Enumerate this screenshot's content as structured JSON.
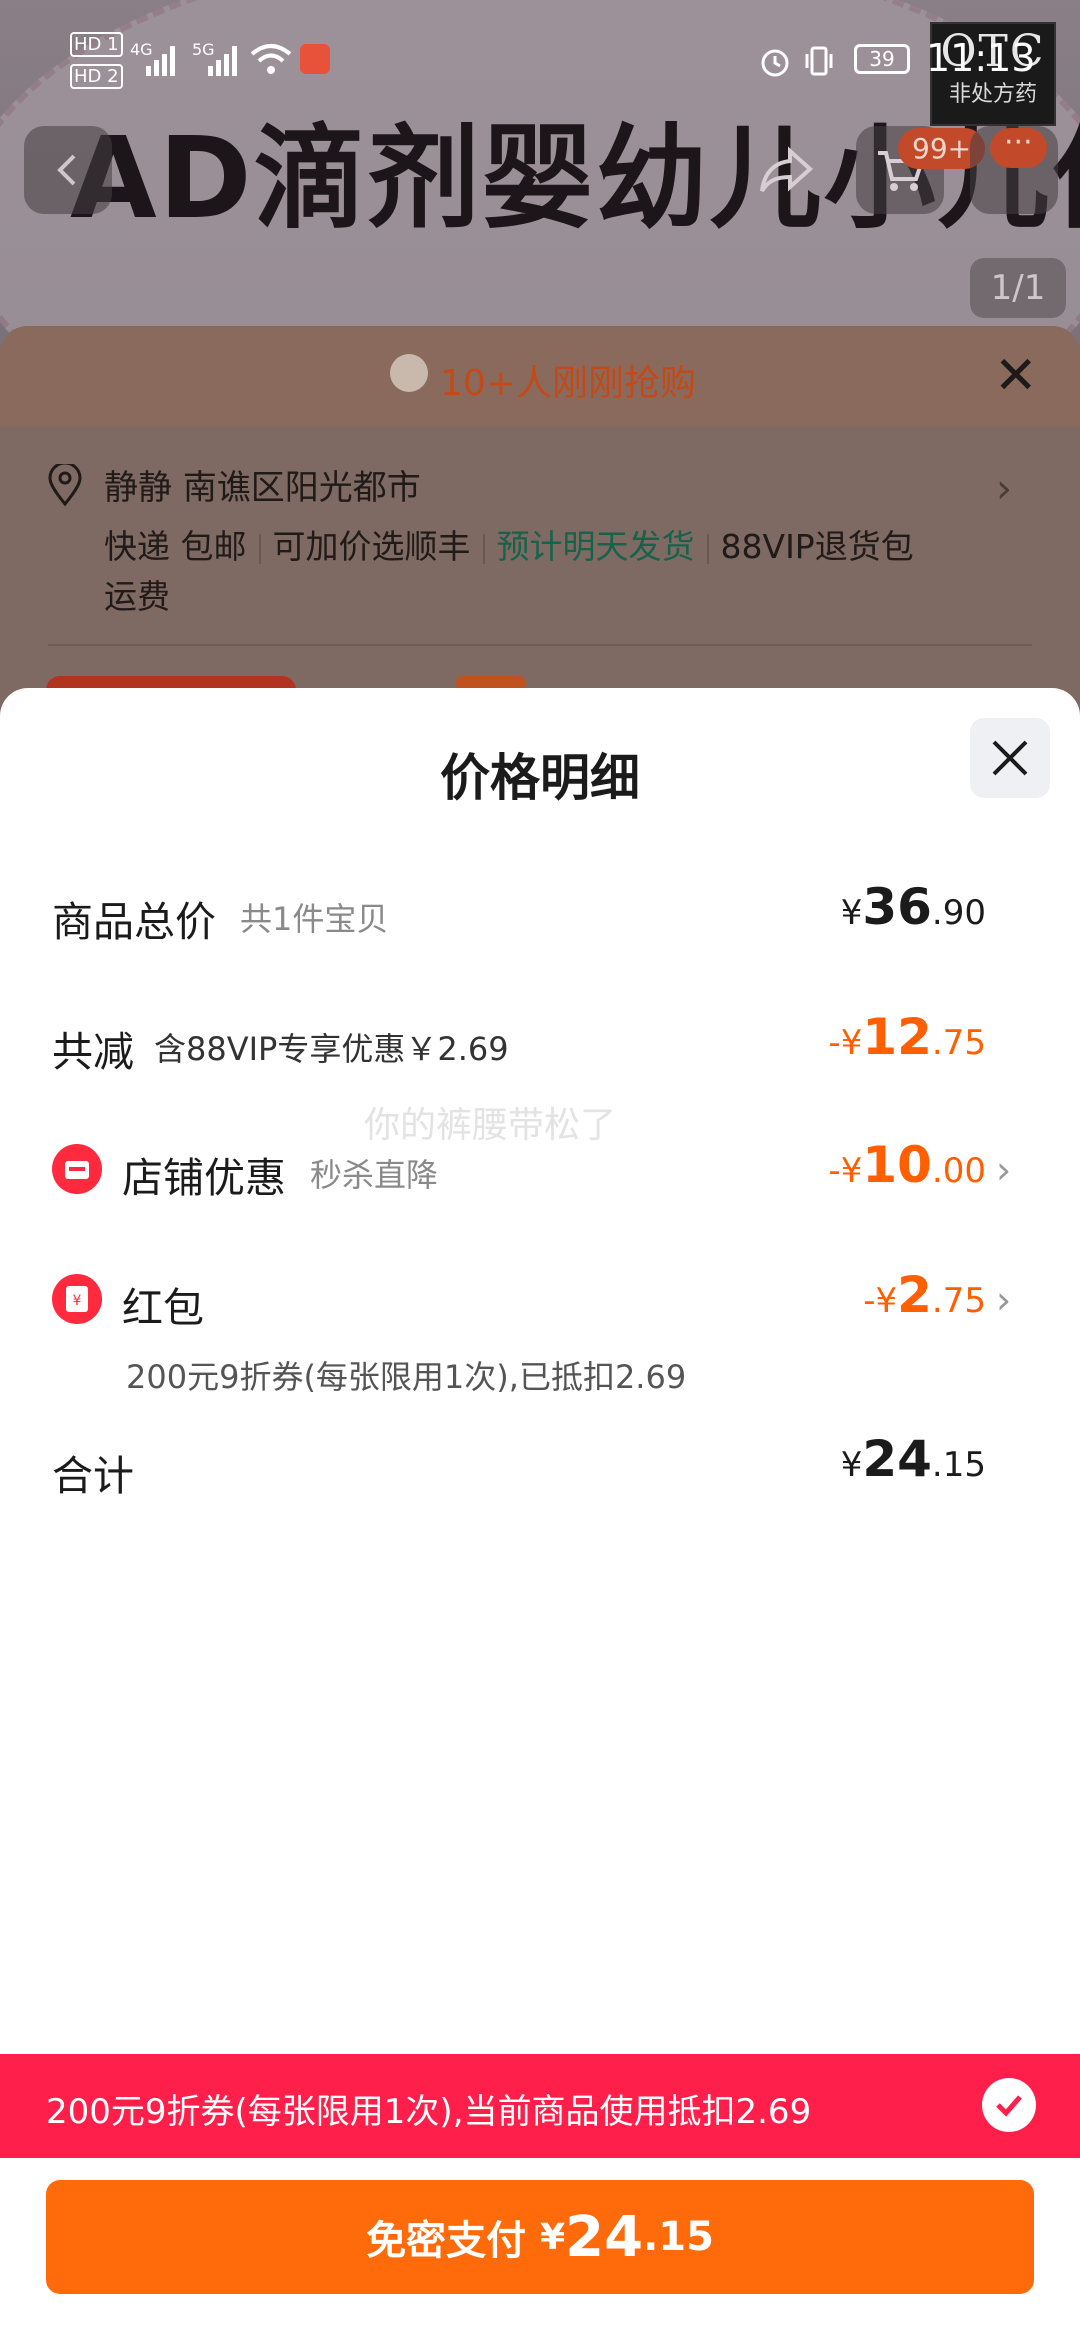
{
  "status_bar": {
    "hd1": "HD 1",
    "hd2": "HD 2",
    "net1": "4G",
    "net2": "5G",
    "battery": "39",
    "time": "11:13"
  },
  "background_page": {
    "product_title": "AD滴剂婴幼儿小儿佝偻病",
    "cart_badge": "99+",
    "more_badge": "···",
    "pager": "1/1",
    "otc_logo": "OTC",
    "otc_sub": "非处方药"
  },
  "order_sheet": {
    "flash_text": "10+人刚刚抢购",
    "address_name": "静静",
    "address_location": "南谯区阳光都市",
    "shipping_items": [
      "快递 包邮",
      "可加价选顺丰",
      "预计明天发货",
      "88VIP退货包"
    ],
    "shipping_cont": "运费"
  },
  "price_detail": {
    "title": "价格明细",
    "total": {
      "label": "商品总价",
      "sub": "共1件宝贝",
      "cur": "¥",
      "int": "36",
      "dec": ".90"
    },
    "reduction": {
      "label": "共减",
      "sub": "含88VIP专享优惠￥2.69",
      "cur": "-¥",
      "int": "12",
      "dec": ".75"
    },
    "watermark": "你的裤腰带松了",
    "store_discount": {
      "label": "店铺优惠",
      "sub": "秒杀直降",
      "cur": "-¥",
      "int": "10",
      "dec": ".00"
    },
    "red_packet": {
      "label": "红包",
      "sub": "200元9折券(每张限用1次),已抵扣2.69",
      "cur": "-¥",
      "int": "2",
      "dec": ".75"
    },
    "sum": {
      "label": "合计",
      "cur": "¥",
      "int": "24",
      "dec": ".15"
    }
  },
  "coupon_bar": {
    "text": "200元9折券(每张限用1次),当前商品使用抵扣2.69"
  },
  "pay_button": {
    "label": "免密支付",
    "cur": "¥",
    "int": "24",
    "dec": ".15"
  },
  "colors": {
    "accent": "#ff6a0a",
    "discount": "#ff5f00",
    "coupon": "#ff1f4a",
    "green": "#16624a"
  }
}
